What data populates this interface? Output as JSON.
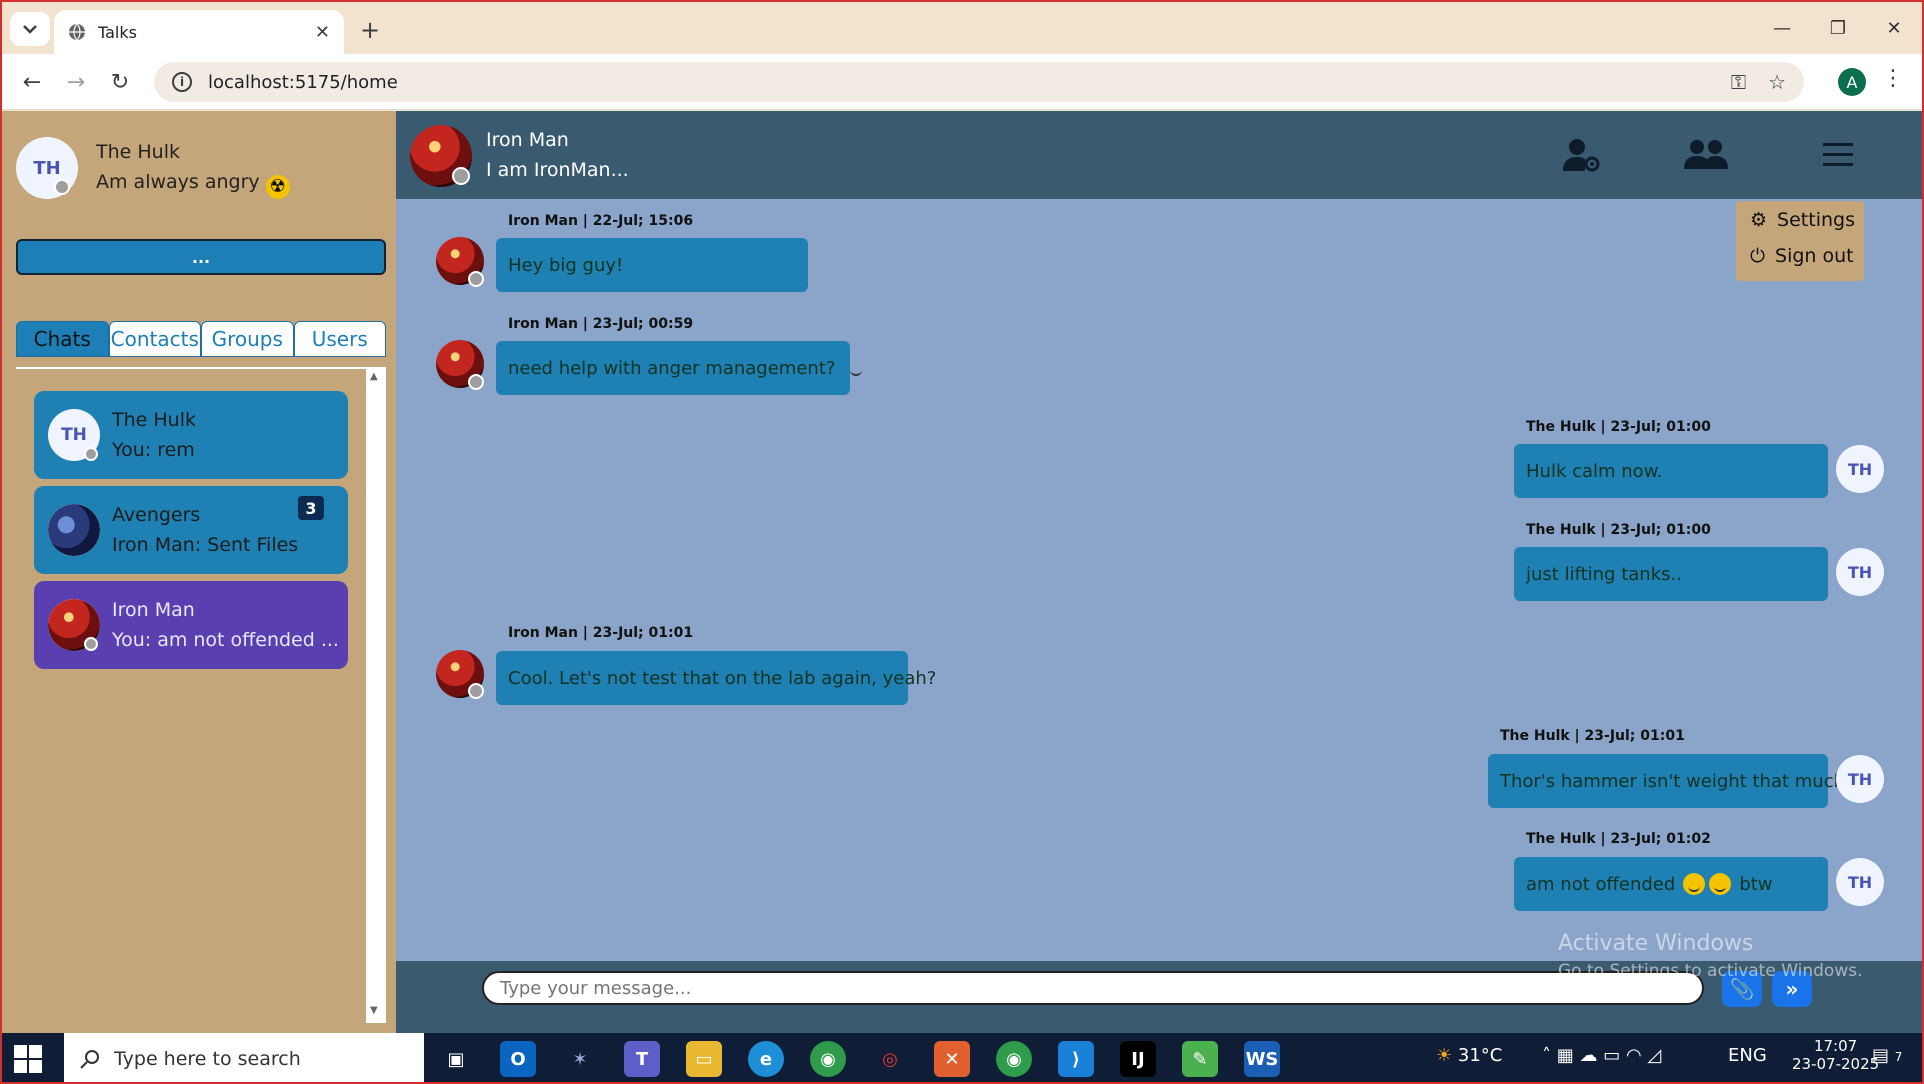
{
  "browser": {
    "tab_title": "Talks",
    "url": "localhost:5175/home",
    "profile_initial": "A"
  },
  "me": {
    "initials": "TH",
    "name": "The Hulk",
    "status_text": "Am always angry"
  },
  "sidebar": {
    "more_label": "...",
    "tabs": [
      "Chats",
      "Contacts",
      "Groups",
      "Users"
    ],
    "active_tab": "Chats",
    "chats": [
      {
        "initials": "TH",
        "name": "The Hulk",
        "last": "You: rem",
        "unread": ""
      },
      {
        "initials": "",
        "name": "Avengers",
        "last": "Iron Man: Sent Files",
        "unread": "3"
      },
      {
        "initials": "",
        "name": "Iron Man",
        "last": "You: am not offended ...",
        "unread": ""
      }
    ]
  },
  "header": {
    "name": "Iron Man",
    "status": "I am IronMan..."
  },
  "menu": {
    "settings": "Settings",
    "sign_out": "Sign out"
  },
  "messages": [
    {
      "meta": "Iron Man | 22-Jul; 15:06",
      "text": "Hey big guy!",
      "side": "left"
    },
    {
      "meta": "Iron Man | 23-Jul; 00:59",
      "text": "need help with anger management?",
      "side": "left"
    },
    {
      "meta": "The Hulk | 23-Jul; 01:00",
      "text": "Hulk calm now.",
      "side": "right"
    },
    {
      "meta": "The Hulk | 23-Jul; 01:00",
      "text": "just lifting tanks..",
      "side": "right"
    },
    {
      "meta": "Iron Man | 23-Jul; 01:01",
      "text": "Cool. Let's not test that on the lab again, yeah?",
      "side": "left"
    },
    {
      "meta": "The Hulk | 23-Jul; 01:01",
      "text": "Thor's hammer isn't weight that much",
      "side": "right"
    },
    {
      "meta": "The Hulk | 23-Jul; 01:02",
      "text_before": "am not offended",
      "text_after": "btw",
      "side": "right"
    }
  ],
  "th_initials": "TH",
  "composer": {
    "placeholder": "Type your message..."
  },
  "watermark": {
    "line1": "Activate Windows",
    "line2": "Go to Settings to activate Windows."
  },
  "taskbar": {
    "search_placeholder": "Type here to search",
    "weather": "31°C",
    "lang": "ENG",
    "time": "17:07",
    "date": "23-07-2025",
    "notifications": "7"
  }
}
